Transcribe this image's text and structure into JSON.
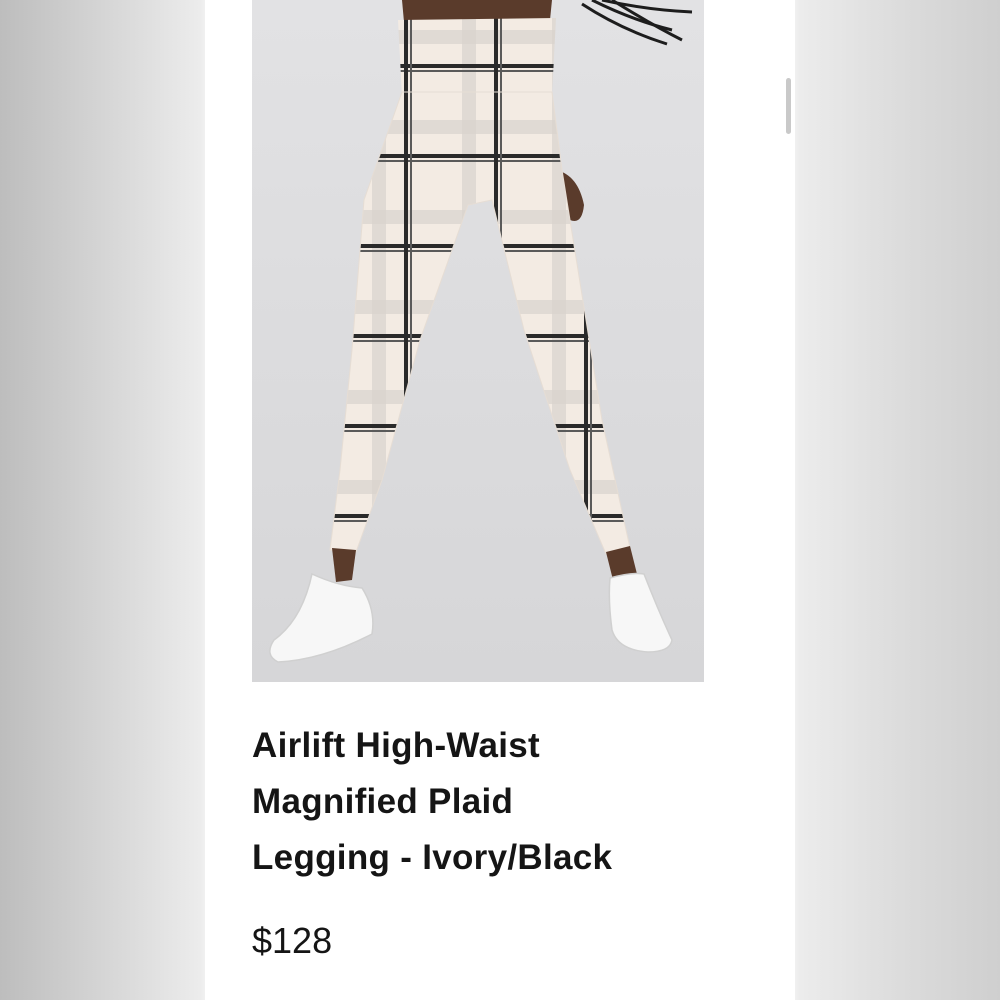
{
  "product": {
    "title_lines": [
      "Airlift High-Waist",
      "Magnified Plaid",
      "Legging - Ivory/Black"
    ],
    "price": "$128",
    "image": {
      "alt": "plaid-legging-photo",
      "fabric_color": "#f3ebe3",
      "plaid_color": "#2a2a2a"
    }
  }
}
